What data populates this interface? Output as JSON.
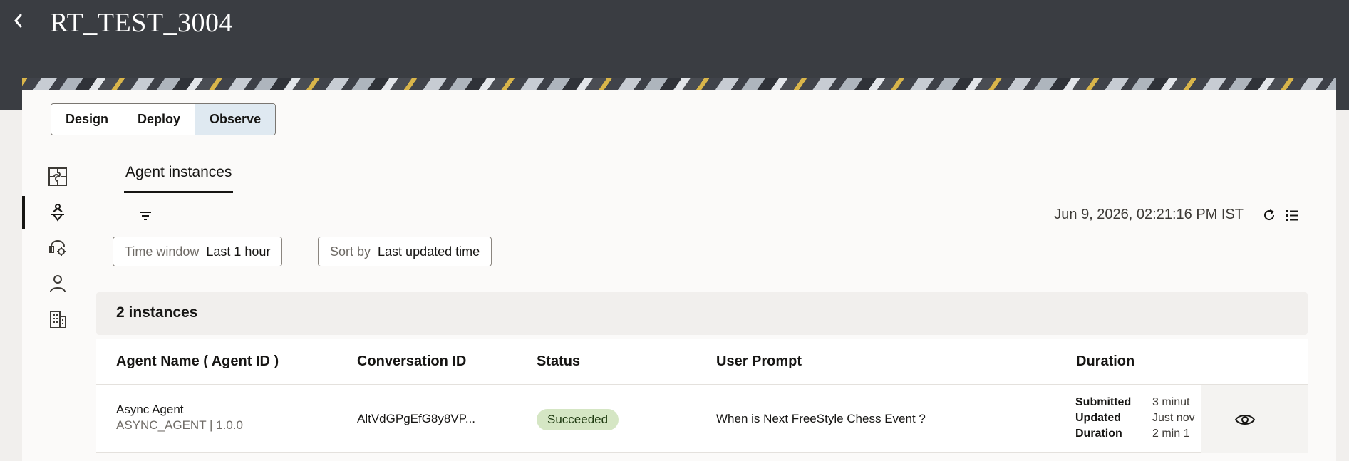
{
  "header": {
    "title": "RT_TEST_3004"
  },
  "mode_switch": {
    "items": [
      "Design",
      "Deploy",
      "Observe"
    ],
    "active": "Observe"
  },
  "side_nav": {
    "icons": [
      "puzzle-flow-icon",
      "agent-observe-icon",
      "agent-tools-icon",
      "person-icon",
      "building-icon"
    ],
    "active_index": 1
  },
  "tabs": [
    {
      "label": "Agent instances",
      "active": true
    }
  ],
  "toolbar": {
    "timestamp": "Jun 9, 2026, 02:21:16 PM IST"
  },
  "filters": {
    "time_window": {
      "label": "Time window",
      "value": "Last 1 hour"
    },
    "sort_by": {
      "label": "Sort by",
      "value": "Last updated time"
    }
  },
  "instances": {
    "count_label": "2 instances"
  },
  "table": {
    "columns": [
      "Agent Name ( Agent ID )",
      "Conversation ID",
      "Status",
      "User Prompt",
      "Duration"
    ],
    "rows": [
      {
        "agent_name": "Async Agent",
        "agent_id": "ASYNC_AGENT | 1.0.0",
        "conversation_id": "AltVdGPgEfG8y8VP...",
        "status": "Succeeded",
        "user_prompt": "When is Next FreeStyle Chess Event ?",
        "duration": {
          "submitted_label": "Submitted",
          "submitted_value": "3 minut",
          "updated_label": "Updated",
          "updated_value": "Just nov",
          "duration_label": "Duration",
          "duration_value": "2 min 1"
        }
      }
    ]
  },
  "colors": {
    "topbar": "#3a3d42",
    "active_mode": "#dfe9f1",
    "status_success": "#d5e6c4"
  }
}
